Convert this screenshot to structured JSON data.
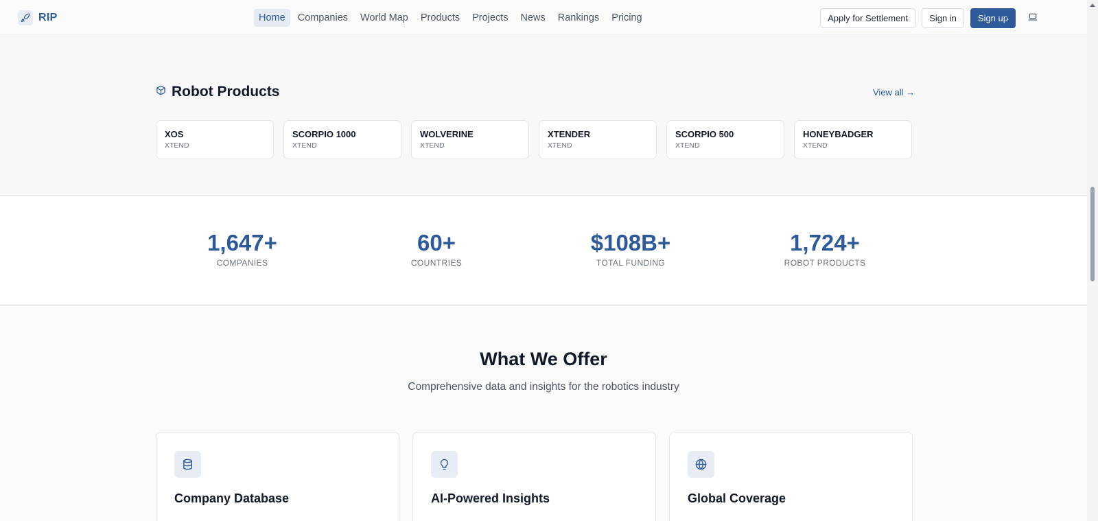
{
  "header": {
    "logo_text": "RIP",
    "nav": [
      {
        "label": "Home",
        "active": true
      },
      {
        "label": "Companies",
        "active": false
      },
      {
        "label": "World Map",
        "active": false
      },
      {
        "label": "Products",
        "active": false
      },
      {
        "label": "Projects",
        "active": false
      },
      {
        "label": "News",
        "active": false
      },
      {
        "label": "Rankings",
        "active": false
      },
      {
        "label": "Pricing",
        "active": false
      }
    ],
    "apply_label": "Apply for Settlement",
    "signin_label": "Sign in",
    "signup_label": "Sign up",
    "theme_icon": "laptop-icon"
  },
  "products": {
    "title": "Robot Products",
    "title_icon": "cube-icon",
    "view_all_label": "View all →",
    "items": [
      {
        "name": "XOS",
        "maker": "XTEND"
      },
      {
        "name": "SCORPIO 1000",
        "maker": "XTEND"
      },
      {
        "name": "WOLVERINE",
        "maker": "XTEND"
      },
      {
        "name": "XTENDER",
        "maker": "XTEND"
      },
      {
        "name": "SCORPIO 500",
        "maker": "XTEND"
      },
      {
        "name": "HONEYBADGER",
        "maker": "XTEND"
      }
    ]
  },
  "stats": [
    {
      "value": "1,647+",
      "label": "COMPANIES"
    },
    {
      "value": "60+",
      "label": "COUNTRIES"
    },
    {
      "value": "$108B+",
      "label": "TOTAL FUNDING"
    },
    {
      "value": "1,724+",
      "label": "ROBOT PRODUCTS"
    }
  ],
  "offer": {
    "title": "What We Offer",
    "subtitle": "Comprehensive data and insights for the robotics industry",
    "cards": [
      {
        "title": "Company Database",
        "icon": "database-icon"
      },
      {
        "title": "AI-Powered Insights",
        "icon": "lightbulb-icon"
      },
      {
        "title": "Global Coverage",
        "icon": "globe-icon"
      }
    ]
  },
  "colors": {
    "accent": "#2d5a9a",
    "background": "#fbfbfc"
  }
}
